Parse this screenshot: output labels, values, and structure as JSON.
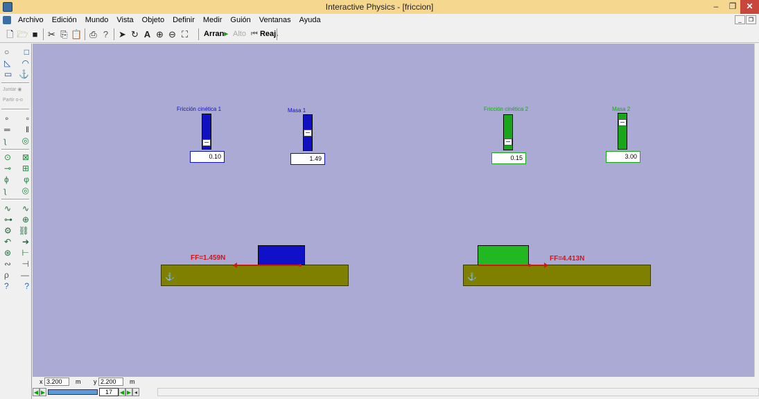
{
  "window": {
    "title": "Interactive Physics - [friccion]",
    "minimize": "–",
    "maximize": "❐",
    "close": "✕"
  },
  "menu": [
    {
      "label": "Archivo"
    },
    {
      "label": "Edición"
    },
    {
      "label": "Mundo"
    },
    {
      "label": "Vista"
    },
    {
      "label": "Objeto"
    },
    {
      "label": "Definir"
    },
    {
      "label": "Medir"
    },
    {
      "label": "Guión"
    },
    {
      "label": "Ventanas"
    },
    {
      "label": "Ayuda"
    }
  ],
  "toolbar": {
    "run_label": "Arran",
    "stop_label": "Alto",
    "reset_label": "Reaj."
  },
  "palette": {
    "join_label": "Juntar",
    "split_label": "Partir"
  },
  "controls": {
    "friction1": {
      "label": "Fricción cinética 1",
      "value": "0.10",
      "level": 0.1,
      "color": "#1010c0"
    },
    "mass1": {
      "label": "Masa 1",
      "value": "1.49",
      "level": 0.5,
      "color": "#1010c0"
    },
    "friction2": {
      "label": "Fricción cinética 2",
      "value": "0.15",
      "level": 0.15,
      "color": "#1aa61a"
    },
    "mass2": {
      "label": "Masa 2",
      "value": "3.00",
      "level": 0.8,
      "color": "#1aa61a"
    }
  },
  "bodies": {
    "block1_color": "#1010c8",
    "block2_color": "#22b822",
    "ground_color": "#808000",
    "force1_label": "FF=1.459N",
    "force2_label": "FF=4.413N"
  },
  "statusbar": {
    "x_label": "x",
    "x_value": "3.200",
    "x_unit": "m",
    "y_label": "y",
    "y_value": "2.200",
    "y_unit": "m",
    "frame": "17"
  }
}
